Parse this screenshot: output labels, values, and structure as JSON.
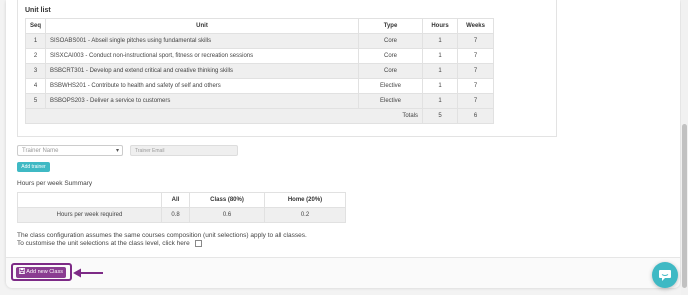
{
  "unit_list": {
    "title": "Unit list",
    "columns": [
      "Seq",
      "Unit",
      "Type",
      "Hours",
      "Weeks"
    ],
    "rows": [
      {
        "seq": "1",
        "unit": "SISOABS001 - Abseil single pitches using fundamental skills",
        "type": "Core",
        "hours": "1",
        "weeks": "7"
      },
      {
        "seq": "2",
        "unit": "SISXCAI003 - Conduct non-instructional sport, fitness or recreation sessions",
        "type": "Core",
        "hours": "1",
        "weeks": "7"
      },
      {
        "seq": "3",
        "unit": "BSBCRT301 - Develop and extend critical and creative thinking skills",
        "type": "Core",
        "hours": "1",
        "weeks": "7"
      },
      {
        "seq": "4",
        "unit": "BSBWHS201 - Contribute to health and safety of self and others",
        "type": "Elective",
        "hours": "1",
        "weeks": "7"
      },
      {
        "seq": "5",
        "unit": "BSBOPS203 - Deliver a service to customers",
        "type": "Elective",
        "hours": "1",
        "weeks": "7"
      }
    ],
    "totals": {
      "label": "Totals",
      "hours": "5",
      "weeks": "6"
    }
  },
  "trainer": {
    "name_placeholder": "Trainer Name",
    "email_placeholder": "Trainer Email",
    "add_button": "Add trainer"
  },
  "hours_summary": {
    "title": "Hours per week Summary",
    "columns": [
      "",
      "All",
      "Class (80%)",
      "Home (20%)"
    ],
    "row": {
      "label": "Hours per week required",
      "all": "0.8",
      "class": "0.6",
      "home": "0.2"
    }
  },
  "notes": {
    "line1": "The class configuration assumes the same courses composition (unit selections) apply to all classes.",
    "line2": "To customise the unit selections at the class level, click here"
  },
  "footer": {
    "add_class_button": "Add new Class"
  },
  "colors": {
    "accent_teal": "#3fb9c4",
    "accent_purple": "#8a3c91",
    "highlight_purple": "#7d2a86"
  },
  "icons": {
    "add_class_icon": "save-icon",
    "chat_icon": "chat-bubble-icon",
    "dropdown_icon": "caret-down-icon",
    "annotation_arrow": "left-arrow-icon"
  }
}
